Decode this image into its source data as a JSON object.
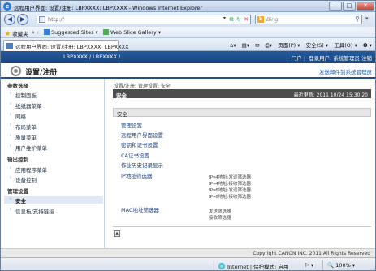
{
  "browser": {
    "title": "远程用户界面: 设置/注册: LBPXXXX: LBPXXXX - Windows Internet Explorer",
    "address": "http://",
    "search_placeholder": "Bing",
    "favorites_label": "收藏夹",
    "suggested_sites": "Suggested Sites ▾",
    "web_slice": "Web Slice Gallery ▾",
    "tab_label": "远程用户界面: 设置/注册: LBPXXXX: LBPXXXX",
    "cmd_page": "页面(P) ▾",
    "cmd_safety": "安全(S) ▾",
    "cmd_tools": "工具(O) ▾",
    "cmd_help": "❷ ▾",
    "status_zone": "Internet | 保护模式: 启用",
    "zoom": "100%"
  },
  "header": {
    "product": "LBPXXXX / LBPXXXX /",
    "portal": "门户",
    "login_user": "登录用户: 系统管理员",
    "logout": "注销",
    "page_title": "设置/注册",
    "mail_link": "发送邮件到系统管理员"
  },
  "sidebar": {
    "groups": [
      {
        "label": "参数选择",
        "items": [
          "控制面板",
          "纸纸器菜单",
          "网络",
          "布局菜单",
          "质量菜单",
          "用户维护菜单"
        ]
      },
      {
        "label": "输出控制",
        "items": [
          "应用程序菜单",
          "设备控制"
        ]
      },
      {
        "label": "管理设置",
        "items": [
          "安全",
          "信息板/支持链接"
        ]
      }
    ],
    "active_item": "安全"
  },
  "main": {
    "breadcrumb": "设置/注册: 管理设置: 安全",
    "section_title": "安全",
    "last_updated": "最近更新: 2011 10/24 15:30:20",
    "sub_header": "安全",
    "links": [
      "管理设置",
      "远程用户界面设置",
      "密钥和证书设置",
      "CA证书设置",
      "作业历史记录显示",
      "IP地址筛选器",
      "MAC地址筛选器"
    ],
    "ip_notes": [
      "IPv4地址:发送筛选器",
      "IPv4地址:接收筛选器",
      "IPv6地址:发送筛选器",
      "IPv6地址:接收筛选器"
    ],
    "mac_notes": [
      "发送筛选器",
      "接收筛选器"
    ],
    "top_button": "▲"
  },
  "footer": {
    "copyright": "Copyright CANON INC. 2011 All Rights Reserved"
  }
}
